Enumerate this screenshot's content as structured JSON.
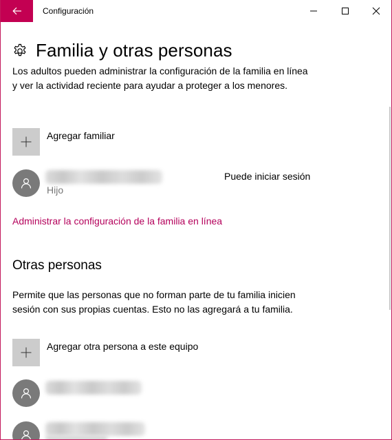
{
  "window": {
    "title": "Configuración",
    "accent_color": "#c30052",
    "controls": {
      "back_icon": "arrow-left-icon",
      "minimize_icon": "minimize-icon",
      "maximize_icon": "maximize-icon",
      "close_icon": "close-icon"
    }
  },
  "page": {
    "icon": "gear-icon",
    "title": "Familia y otras personas",
    "family_description": "Los adultos pueden administrar la configuración de la familia en línea y ver la actividad reciente para ayudar a proteger a los menores.",
    "add_family_label": "Agregar familiar",
    "family_members": [
      {
        "name": "",
        "role": "Hijo",
        "status": "Puede iniciar sesión",
        "avatar_icon": "person-icon"
      }
    ],
    "manage_link": "Administrar la configuración de la familia en línea",
    "link_color": "#b4005b",
    "other_section_title": "Otras personas",
    "other_description": "Permite que las personas que no forman parte de tu familia inicien sesión con sus propias cuentas. Esto no las agregará a tu familia.",
    "add_other_label": "Agregar otra persona a este equipo",
    "other_people": [
      {
        "name": "",
        "avatar_icon": "person-icon"
      },
      {
        "name": "",
        "avatar_icon": "person-icon"
      }
    ]
  }
}
